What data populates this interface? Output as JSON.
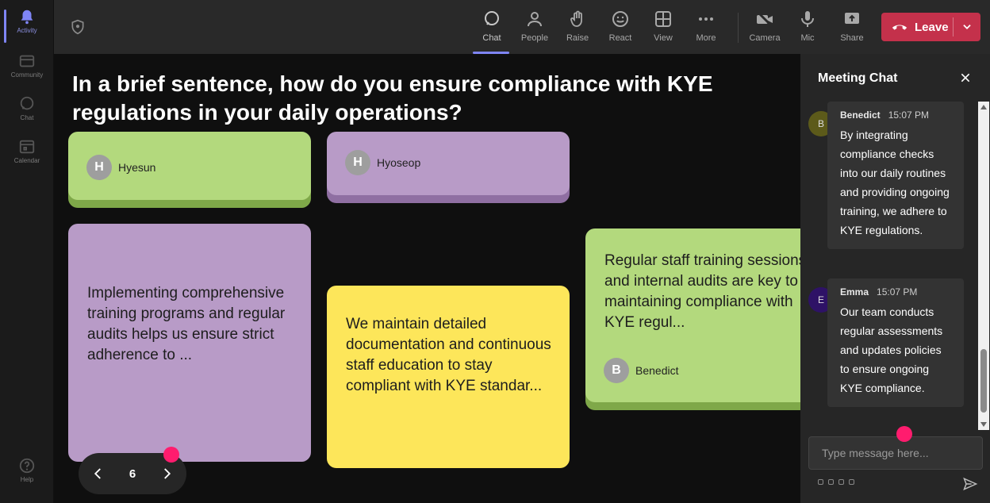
{
  "rail": {
    "activity": "Activity",
    "community": "Community",
    "chat": "Chat",
    "calendar": "Calendar",
    "help": "Help"
  },
  "toolbar": {
    "chat": "Chat",
    "people": "People",
    "raise": "Raise",
    "react": "React",
    "view": "View",
    "more": "More",
    "camera": "Camera",
    "mic": "Mic",
    "share": "Share",
    "leave": "Leave"
  },
  "question": "In a brief sentence, how do you ensure compliance with KYE regulations in your daily operations?",
  "cards": [
    {
      "author_initial": "H",
      "author": "Hyesun",
      "color": "#b3d97d"
    },
    {
      "author_initial": "H",
      "author": "Hyoseop",
      "color": "#b89bc7"
    },
    {
      "text": "Implementing comprehensive training programs and regular audits helps us ensure strict adherence to ...",
      "color": "#b89bc7"
    },
    {
      "text": "We maintain detailed documentation and continuous staff education to stay compliant with KYE standar...",
      "color": "#fde65a"
    },
    {
      "text": "Regular staff training sessions and internal audits are key to maintaining compliance with KYE regul...",
      "author_initial": "B",
      "author": "Benedict",
      "color": "#b3d97d"
    }
  ],
  "pager": {
    "page": "6"
  },
  "chat": {
    "title": "Meeting Chat",
    "messages": [
      {
        "initial": "B",
        "name": "Benedict",
        "time": "15:07 PM",
        "text": "By integrating compliance checks into our daily routines and providing ongoing training, we adhere to KYE regulations.",
        "avatar_color": "#5c5a1a"
      },
      {
        "initial": "E",
        "name": "Emma",
        "time": "15:07 PM",
        "text": "Our team conducts regular assessments and updates policies to ensure ongoing KYE compliance.",
        "avatar_color": "#2e1266"
      }
    ],
    "input_placeholder": "Type message here..."
  },
  "colors": {
    "accent": "#7f85f5",
    "leave": "#c4314b",
    "marker": "#ff1c6e"
  }
}
